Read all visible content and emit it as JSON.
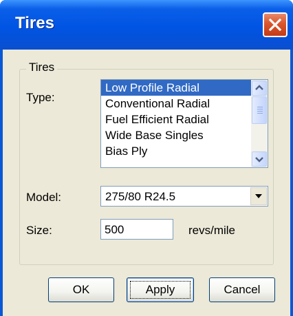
{
  "window": {
    "title": "Tires",
    "close_icon": "close-icon"
  },
  "group": {
    "label": "Tires"
  },
  "type": {
    "label": "Type:",
    "options": [
      "Low Profile Radial",
      "Conventional Radial",
      "Fuel Efficient Radial",
      "Wide Base Singles",
      "Bias Ply"
    ],
    "selected": "Low Profile Radial"
  },
  "model": {
    "label": "Model:",
    "value": "275/80 R24.5",
    "dropdown_icon": "chevron-down-icon"
  },
  "size": {
    "label": "Size:",
    "value": "500",
    "unit": "revs/mile"
  },
  "buttons": {
    "ok": "OK",
    "apply": "Apply",
    "cancel": "Cancel"
  },
  "colors": {
    "title_bar": "#0054e3",
    "selection": "#316ac5",
    "close_button": "#d9562e",
    "dialog_background": "#ece9d8"
  }
}
